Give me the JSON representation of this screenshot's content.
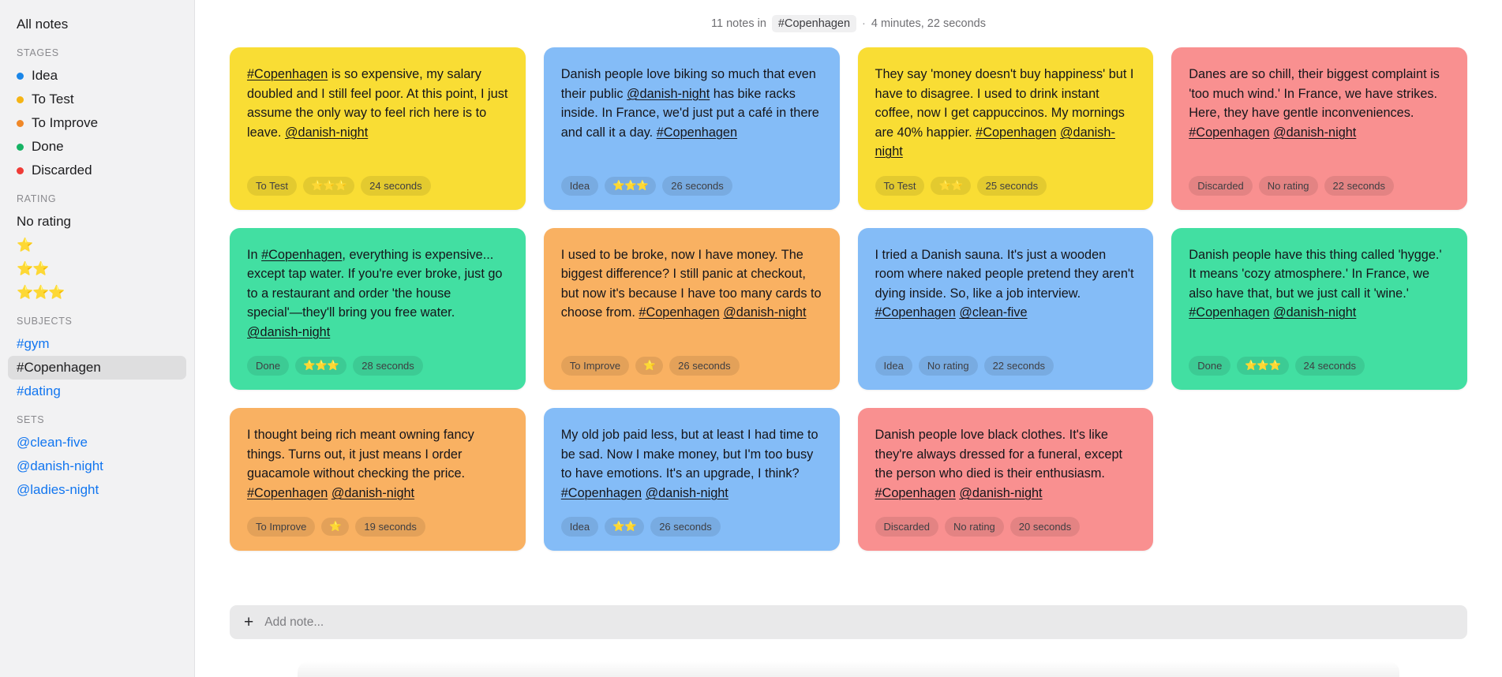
{
  "sidebar": {
    "all_notes_label": "All notes",
    "groups": [
      {
        "label": "STAGES",
        "items": [
          {
            "label": "Idea",
            "color": "#1a86e8",
            "type": "dot"
          },
          {
            "label": "To Test",
            "color": "#f5b415",
            "type": "dot"
          },
          {
            "label": "To Improve",
            "color": "#f08828",
            "type": "dot"
          },
          {
            "label": "Done",
            "color": "#16b364",
            "type": "dot"
          },
          {
            "label": "Discarded",
            "color": "#ef3b36",
            "type": "dot"
          }
        ]
      },
      {
        "label": "RATING",
        "items": [
          {
            "label": "No rating",
            "type": "plain"
          },
          {
            "label": "⭐",
            "type": "stars"
          },
          {
            "label": "⭐⭐",
            "type": "stars"
          },
          {
            "label": "⭐⭐⭐",
            "type": "stars"
          }
        ]
      },
      {
        "label": "SUBJECTS",
        "items": [
          {
            "label": "#gym",
            "type": "link"
          },
          {
            "label": "#Copenhagen",
            "type": "active"
          },
          {
            "label": "#dating",
            "type": "link"
          }
        ]
      },
      {
        "label": "SETS",
        "items": [
          {
            "label": "@clean-five",
            "type": "link"
          },
          {
            "label": "@danish-night",
            "type": "link"
          },
          {
            "label": "@ladies-night",
            "type": "link"
          }
        ]
      }
    ]
  },
  "header": {
    "count_text": "11 notes in",
    "filter_tag": "#Copenhagen",
    "separator": "·",
    "duration": "4 minutes, 22 seconds"
  },
  "notes": [
    {
      "color": "c-yellow",
      "segments": [
        {
          "t": "#Copenhagen",
          "link": true
        },
        {
          "t": " is so expensive, my salary doubled and I still feel poor. At this point, I just assume the only way to feel rich here is to leave. ",
          "link": false
        },
        {
          "t": "@danish-night",
          "link": true
        }
      ],
      "stage": "To Test",
      "rating": "⭐⭐⭐",
      "rating_is_stars": true,
      "time": "24 seconds"
    },
    {
      "color": "c-blue",
      "segments": [
        {
          "t": "Danish people love biking so much that even their public ",
          "link": false
        },
        {
          "t": "@danish-night",
          "link": true
        },
        {
          "t": " has bike racks inside. In France, we'd just put a café in there and call it a day. ",
          "link": false
        },
        {
          "t": "#Copenhagen",
          "link": true
        }
      ],
      "stage": "Idea",
      "rating": "⭐⭐⭐",
      "rating_is_stars": true,
      "time": "26 seconds"
    },
    {
      "color": "c-yellow",
      "segments": [
        {
          "t": "They say 'money doesn't buy happiness' but I have to disagree. I used to drink instant coffee, now I get cappuccinos. My mornings are 40% happier. ",
          "link": false
        },
        {
          "t": "#Copenhagen",
          "link": true
        },
        {
          "t": " ",
          "link": false
        },
        {
          "t": "@danish-night",
          "link": true
        }
      ],
      "stage": "To Test",
      "rating": "⭐⭐",
      "rating_is_stars": true,
      "time": "25 seconds"
    },
    {
      "color": "c-red",
      "segments": [
        {
          "t": "Danes are so chill, their biggest complaint is 'too much wind.' In France, we have strikes. Here, they have gentle inconveniences. ",
          "link": false
        },
        {
          "t": "#Copenhagen",
          "link": true
        },
        {
          "t": " ",
          "link": false
        },
        {
          "t": "@danish-night",
          "link": true
        }
      ],
      "stage": "Discarded",
      "rating": "No rating",
      "rating_is_stars": false,
      "time": "22 seconds"
    },
    {
      "color": "c-green",
      "segments": [
        {
          "t": "In ",
          "link": false
        },
        {
          "t": "#Copenhagen",
          "link": true
        },
        {
          "t": ", everything is expensive... except tap water. If you're ever broke, just go to a restaurant and order 'the house special'—they'll bring you free water. ",
          "link": false
        },
        {
          "t": "@danish-night",
          "link": true
        }
      ],
      "stage": "Done",
      "rating": "⭐⭐⭐",
      "rating_is_stars": true,
      "time": "28 seconds"
    },
    {
      "color": "c-orange",
      "segments": [
        {
          "t": "I used to be broke, now I have money. The biggest difference? I still panic at checkout, but now it's because I have too many cards to choose from. ",
          "link": false
        },
        {
          "t": "#Copenhagen",
          "link": true
        },
        {
          "t": " ",
          "link": false
        },
        {
          "t": "@danish-night",
          "link": true
        }
      ],
      "stage": "To Improve",
      "rating": "⭐",
      "rating_is_stars": true,
      "time": "26 seconds"
    },
    {
      "color": "c-blue",
      "segments": [
        {
          "t": "I tried a Danish sauna. It's just a wooden room where naked people pretend they aren't dying inside. So, like a job interview. ",
          "link": false
        },
        {
          "t": "#Copenhagen",
          "link": true
        },
        {
          "t": " ",
          "link": false
        },
        {
          "t": "@clean-five",
          "link": true
        }
      ],
      "stage": "Idea",
      "rating": "No rating",
      "rating_is_stars": false,
      "time": "22 seconds"
    },
    {
      "color": "c-green",
      "segments": [
        {
          "t": "Danish people have this thing called 'hygge.' It means 'cozy atmosphere.' In France, we also have that, but we just call it 'wine.' ",
          "link": false
        },
        {
          "t": "#Copenhagen",
          "link": true
        },
        {
          "t": " ",
          "link": false
        },
        {
          "t": "@danish-night",
          "link": true
        }
      ],
      "stage": "Done",
      "rating": "⭐⭐⭐",
      "rating_is_stars": true,
      "time": "24 seconds"
    },
    {
      "color": "c-orange",
      "segments": [
        {
          "t": "I thought being rich meant owning fancy things. Turns out, it just means I order guacamole without checking the price. ",
          "link": false
        },
        {
          "t": "#Copenhagen",
          "link": true
        },
        {
          "t": " ",
          "link": false
        },
        {
          "t": "@danish-night",
          "link": true
        }
      ],
      "stage": "To Improve",
      "rating": "⭐",
      "rating_is_stars": true,
      "time": "19 seconds"
    },
    {
      "color": "c-blue",
      "segments": [
        {
          "t": "My old job paid less, but at least I had time to be sad. Now I make money, but I'm too busy to have emotions. It's an upgrade, I think? ",
          "link": false
        },
        {
          "t": "#Copenhagen",
          "link": true
        },
        {
          "t": " ",
          "link": false
        },
        {
          "t": "@danish-night",
          "link": true
        }
      ],
      "stage": "Idea",
      "rating": "⭐⭐",
      "rating_is_stars": true,
      "time": "26 seconds"
    },
    {
      "color": "c-red",
      "segments": [
        {
          "t": "Danish people love black clothes. It's like they're always dressed for a funeral, except the person who died is their enthusiasm. ",
          "link": false
        },
        {
          "t": "#Copenhagen",
          "link": true
        },
        {
          "t": " ",
          "link": false
        },
        {
          "t": "@danish-night",
          "link": true
        }
      ],
      "stage": "Discarded",
      "rating": "No rating",
      "rating_is_stars": false,
      "time": "20 seconds"
    }
  ],
  "add_note": {
    "icon": "plus-icon",
    "placeholder": "Add note..."
  }
}
